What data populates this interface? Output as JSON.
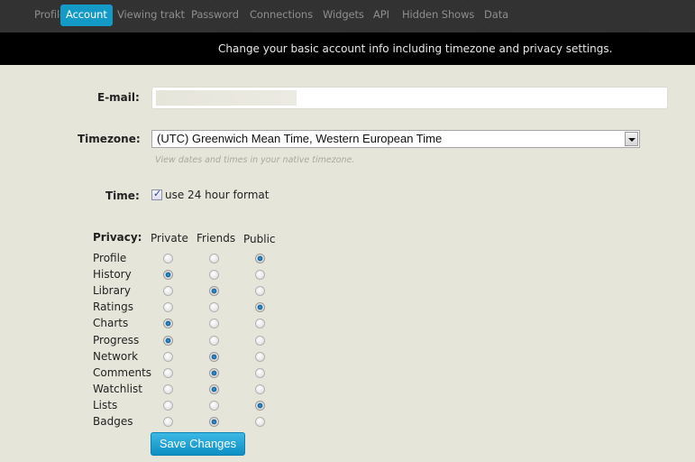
{
  "nav": {
    "tabs": [
      {
        "label": "Profile",
        "active": false
      },
      {
        "label": "Account",
        "active": true
      },
      {
        "label": "Viewing trakt",
        "active": false
      },
      {
        "label": "Password",
        "active": false
      },
      {
        "label": "Connections",
        "active": false
      },
      {
        "label": "Widgets",
        "active": false
      },
      {
        "label": "API",
        "active": false
      },
      {
        "label": "Hidden Shows",
        "active": false
      },
      {
        "label": "Data",
        "active": false
      }
    ]
  },
  "banner": {
    "text": "Change your basic account info including timezone and privacy settings."
  },
  "form": {
    "email": {
      "label": "E-mail:",
      "value": ""
    },
    "timezone": {
      "label": "Timezone:",
      "selected": "(UTC) Greenwich Mean Time, Western European Time",
      "hint": "View dates and times in your native timezone."
    },
    "time": {
      "label": "Time:",
      "checkbox_label": "use 24 hour format",
      "checked": true
    },
    "privacy": {
      "label": "Privacy:",
      "columns": [
        "Private",
        "Friends",
        "Public"
      ],
      "rows": [
        {
          "name": "Profile",
          "selected": "Public"
        },
        {
          "name": "History",
          "selected": "Private"
        },
        {
          "name": "Library",
          "selected": "Friends"
        },
        {
          "name": "Ratings",
          "selected": "Public"
        },
        {
          "name": "Charts",
          "selected": "Private"
        },
        {
          "name": "Progress",
          "selected": "Private"
        },
        {
          "name": "Network",
          "selected": "Friends"
        },
        {
          "name": "Comments",
          "selected": "Friends"
        },
        {
          "name": "Watchlist",
          "selected": "Friends"
        },
        {
          "name": "Lists",
          "selected": "Public"
        },
        {
          "name": "Badges",
          "selected": "Friends"
        }
      ]
    },
    "save_label": "Save Changes"
  }
}
